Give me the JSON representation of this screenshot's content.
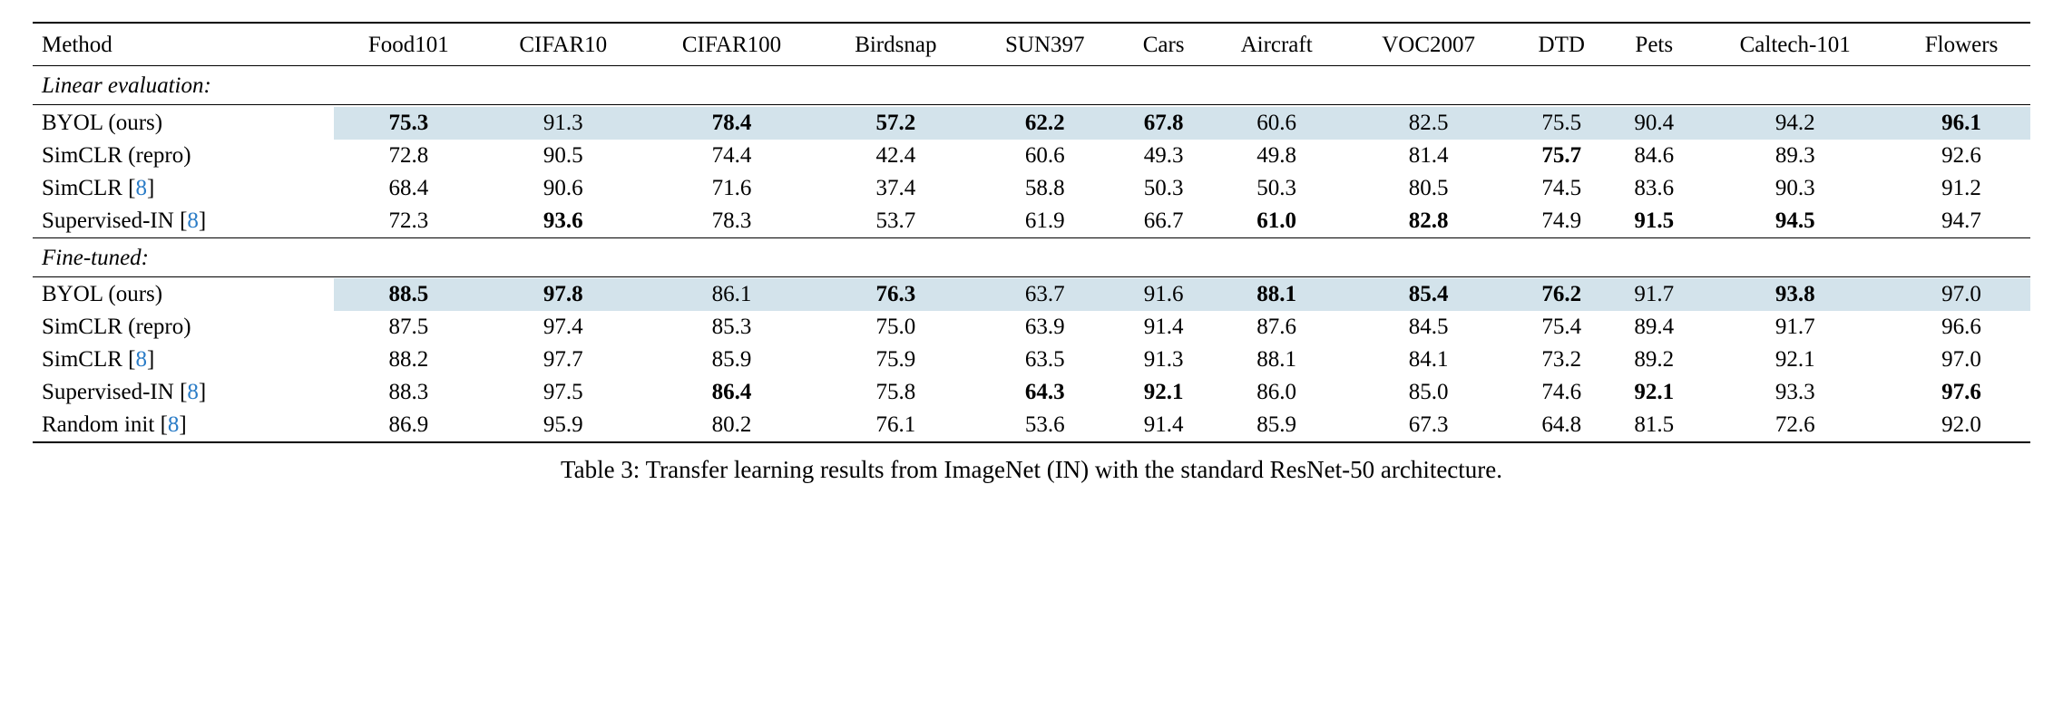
{
  "chart_data": {
    "type": "table",
    "title": "Table 3: Transfer learning results from ImageNet (IN) with the standard ResNet-50 architecture.",
    "columns": [
      "Method",
      "Food101",
      "CIFAR10",
      "CIFAR100",
      "Birdsnap",
      "SUN397",
      "Cars",
      "Aircraft",
      "VOC2007",
      "DTD",
      "Pets",
      "Caltech-101",
      "Flowers"
    ],
    "sections": [
      {
        "name": "Linear evaluation:",
        "rows": [
          {
            "method": "BYOL (ours)",
            "cite": null,
            "highlight": true,
            "values": [
              75.3,
              91.3,
              78.4,
              57.2,
              62.2,
              67.8,
              60.6,
              82.5,
              75.5,
              90.4,
              94.2,
              96.1
            ],
            "bold": [
              true,
              false,
              true,
              true,
              true,
              true,
              false,
              false,
              false,
              false,
              false,
              true
            ]
          },
          {
            "method": "SimCLR (repro)",
            "cite": null,
            "highlight": false,
            "values": [
              72.8,
              90.5,
              74.4,
              42.4,
              60.6,
              49.3,
              49.8,
              81.4,
              75.7,
              84.6,
              89.3,
              92.6
            ],
            "bold": [
              false,
              false,
              false,
              false,
              false,
              false,
              false,
              false,
              true,
              false,
              false,
              false
            ]
          },
          {
            "method": "SimCLR",
            "cite": "8",
            "highlight": false,
            "values": [
              68.4,
              90.6,
              71.6,
              37.4,
              58.8,
              50.3,
              50.3,
              80.5,
              74.5,
              83.6,
              90.3,
              91.2
            ],
            "bold": [
              false,
              false,
              false,
              false,
              false,
              false,
              false,
              false,
              false,
              false,
              false,
              false
            ]
          },
          {
            "method": "Supervised-IN",
            "cite": "8",
            "highlight": false,
            "values": [
              72.3,
              93.6,
              78.3,
              53.7,
              61.9,
              66.7,
              61.0,
              82.8,
              74.9,
              91.5,
              94.5,
              94.7
            ],
            "bold": [
              false,
              true,
              false,
              false,
              false,
              false,
              true,
              true,
              false,
              true,
              true,
              false
            ]
          }
        ]
      },
      {
        "name": "Fine-tuned:",
        "rows": [
          {
            "method": "BYOL (ours)",
            "cite": null,
            "highlight": true,
            "values": [
              88.5,
              97.8,
              86.1,
              76.3,
              63.7,
              91.6,
              88.1,
              85.4,
              76.2,
              91.7,
              93.8,
              97.0
            ],
            "bold": [
              true,
              true,
              false,
              true,
              false,
              false,
              true,
              true,
              true,
              false,
              true,
              false
            ]
          },
          {
            "method": "SimCLR (repro)",
            "cite": null,
            "highlight": false,
            "values": [
              87.5,
              97.4,
              85.3,
              75.0,
              63.9,
              91.4,
              87.6,
              84.5,
              75.4,
              89.4,
              91.7,
              96.6
            ],
            "bold": [
              false,
              false,
              false,
              false,
              false,
              false,
              false,
              false,
              false,
              false,
              false,
              false
            ]
          },
          {
            "method": "SimCLR",
            "cite": "8",
            "highlight": false,
            "values": [
              88.2,
              97.7,
              85.9,
              75.9,
              63.5,
              91.3,
              88.1,
              84.1,
              73.2,
              89.2,
              92.1,
              97.0
            ],
            "bold": [
              false,
              false,
              false,
              false,
              false,
              false,
              false,
              false,
              false,
              false,
              false,
              false
            ]
          },
          {
            "method": "Supervised-IN",
            "cite": "8",
            "highlight": false,
            "values": [
              88.3,
              97.5,
              86.4,
              75.8,
              64.3,
              92.1,
              86.0,
              85.0,
              74.6,
              92.1,
              93.3,
              97.6
            ],
            "bold": [
              false,
              false,
              true,
              false,
              true,
              true,
              false,
              false,
              false,
              true,
              false,
              true
            ]
          },
          {
            "method": "Random init",
            "cite": "8",
            "highlight": false,
            "values": [
              86.9,
              95.9,
              80.2,
              76.1,
              53.6,
              91.4,
              85.9,
              67.3,
              64.8,
              81.5,
              72.6,
              92.0
            ],
            "bold": [
              false,
              false,
              false,
              false,
              false,
              false,
              false,
              false,
              false,
              false,
              false,
              false
            ]
          }
        ]
      }
    ]
  },
  "caption_prefix": "Table 3: ",
  "caption_body": "Transfer learning results from ImageNet (IN) with the standard ResNet-50 architecture."
}
